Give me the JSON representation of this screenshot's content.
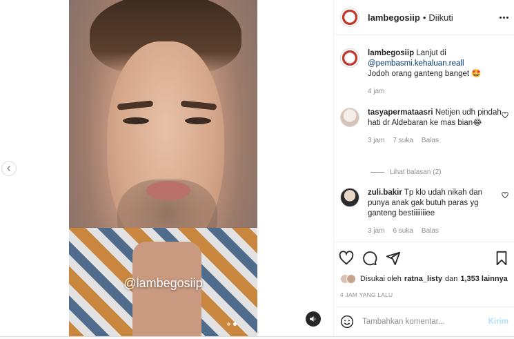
{
  "post": {
    "video_watermark": "@lambegosiip",
    "carousel": {
      "slide_count": 2,
      "active_index": 1
    }
  },
  "header": {
    "username": "lambegosiip",
    "separator": "•",
    "follow_status": "Diikuti"
  },
  "caption": {
    "username": "lambegosiip",
    "text_prefix": "Lanjut di",
    "mention": "@pembasmi.kehaluan.reall",
    "text_suffix": "Jodoh orang ganteng banget 🤩",
    "time": "4 jam"
  },
  "comments": [
    {
      "username": "tasyapermataasri",
      "text": "Netijen udh pindah hati dr Aldebaran ke mas bian😂",
      "time": "3 jam",
      "likes": "7 suka",
      "reply": "Balas"
    },
    {
      "username": "zuli.bakir",
      "text": "Tp klo udah nikah dan punya anak gak butuh paras yg ganteng bestiiiiiiiee",
      "time": "3 jam",
      "likes": "6 suka",
      "reply": "Balas"
    }
  ],
  "view_replies": "Lihat balasan (2)",
  "likes_line": {
    "prefix": "Disukai oleh",
    "user": "ratna_listy",
    "middle": "dan",
    "count": "1,353 lainnya"
  },
  "timestamp": "4 JAM YANG LALU",
  "add_comment": {
    "placeholder": "Tambahkan komentar...",
    "post_label": "Kirim"
  },
  "colors": {
    "link": "#00376b",
    "muted": "#8e8e8e",
    "post_disabled": "#b2dffc",
    "text": "#262626"
  }
}
